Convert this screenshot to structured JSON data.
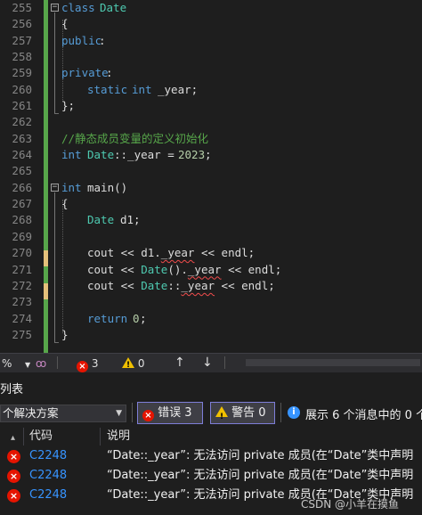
{
  "editor": {
    "line_numbers": [
      "255",
      "256",
      "257",
      "258",
      "259",
      "260",
      "261",
      "262",
      "263",
      "264",
      "265",
      "266",
      "267",
      "268",
      "269",
      "270",
      "271",
      "272",
      "273",
      "274",
      "275"
    ],
    "lines": {
      "l255": {
        "kw": "class",
        "name": "Date"
      },
      "l256": {
        "text": "{"
      },
      "l257": {
        "kw": "public",
        "punct": ":"
      },
      "l259": {
        "kw": "private",
        "punct": ":"
      },
      "l260": {
        "kw1": "static",
        "kw2": "int",
        "rest": "_year;"
      },
      "l261": {
        "text": "};"
      },
      "l263": {
        "comment": "//静态成员变量的定义初始化"
      },
      "l264": {
        "kw": "int",
        "type": "Date",
        "rest": "::_year = ",
        "num": "2023",
        "end": ";"
      },
      "l266": {
        "kw": "int",
        "rest": "main()"
      },
      "l267": {
        "text": "{"
      },
      "l268": {
        "type": "Date",
        "rest": "d1;"
      },
      "l270": {
        "pre": "cout << d1.",
        "err": "_year",
        "post": " << endl;"
      },
      "l271": {
        "pre": "cout << ",
        "type": "Date",
        "mid": "().",
        "err": "_year",
        "post": " << endl;"
      },
      "l272": {
        "pre": "cout << ",
        "type": "Date",
        "mid": "::",
        "err": "_year",
        "post": " << endl;"
      },
      "l274": {
        "kw": "return",
        "num": "0",
        "end": ";"
      },
      "l275": {
        "text": "}"
      }
    }
  },
  "status_strip": {
    "zoom": "%",
    "error_count": "3",
    "warning_count": "0",
    "up_arrow": "↑",
    "down_arrow": "↓"
  },
  "error_list": {
    "title": "列表",
    "scope": "个解决方案",
    "errors_button": "错误 3",
    "warnings_button": "警告 0",
    "info_text": "展示 6 个消息中的 0 个",
    "columns": {
      "code": "代码",
      "description": "说明"
    },
    "rows": [
      {
        "code": "C2248",
        "description": "“Date::_year”: 无法访问 private 成员(在“Date”类中声明"
      },
      {
        "code": "C2248",
        "description": "“Date::_year”: 无法访问 private 成员(在“Date”类中声明"
      },
      {
        "code": "C2248",
        "description": "“Date::_year”: 无法访问 private 成员(在“Date”类中声明"
      }
    ]
  },
  "watermark": "CSDN @小羊在摸鱼",
  "colors": {
    "background": "#1e1e1e",
    "keyword": "#569cd6",
    "type": "#4ec9b0",
    "number": "#b5cea8",
    "comment": "#57a64a",
    "error": "#e51400",
    "link": "#3794ff",
    "change_bar": "#57a64a"
  }
}
